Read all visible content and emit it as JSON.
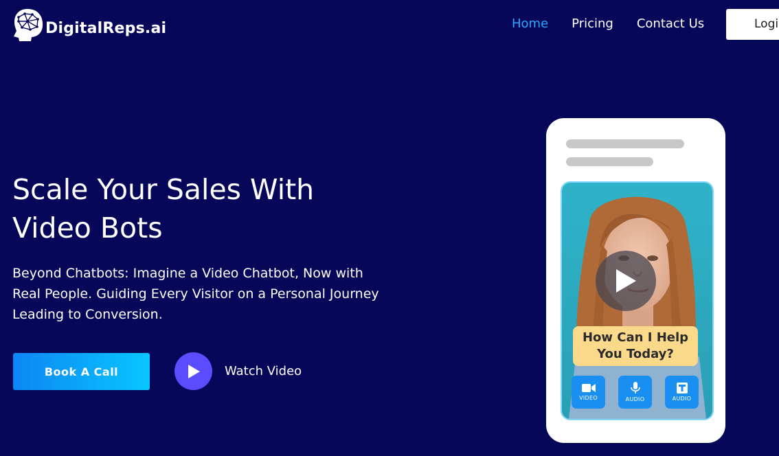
{
  "header": {
    "logo_text": "DigitalReps.ai",
    "logo_icon": "head-network-icon",
    "nav": [
      {
        "label": "Home",
        "active": true
      },
      {
        "label": "Pricing",
        "active": false
      },
      {
        "label": "Contact Us",
        "active": false
      }
    ],
    "login_label": "Login"
  },
  "hero": {
    "title_line1": "Scale Your Sales With",
    "title_line2": "Video Bots",
    "subtitle_line1": "Beyond Chatbots: Imagine a Video Chatbot, Now with",
    "subtitle_line2": "Real People. Guiding Every Visitor on a Personal Journey",
    "subtitle_line3": "Leading to Conversion.",
    "book_call_label": "Book A Call",
    "watch_video_label": "Watch Video"
  },
  "phone": {
    "speech_line1": "How Can I Help",
    "speech_line2": "You Today?",
    "buttons": [
      {
        "icon": "video-camera-icon",
        "label": "VIDEO"
      },
      {
        "icon": "microphone-icon",
        "label": "AUDIO"
      },
      {
        "icon": "text-t-icon",
        "label": "AUDIO"
      }
    ]
  },
  "colors": {
    "background": "#07075a",
    "nav_active": "#29a9ff",
    "book_btn_start": "#0d86f4",
    "book_btn_end": "#08c6ff",
    "watch_circle": "#5a4cff",
    "speech_bubble": "#fbd98a",
    "mini_button": "#1a8ff2"
  }
}
